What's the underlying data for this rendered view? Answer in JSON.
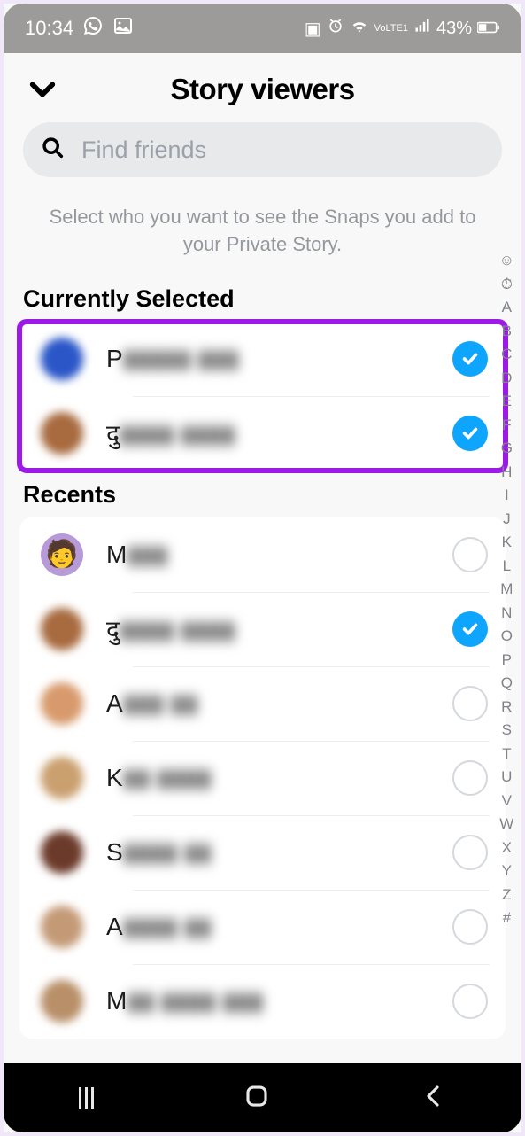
{
  "status": {
    "time": "10:34",
    "battery": "43%",
    "icons": {
      "whatsapp": "whatsapp-icon",
      "screenshot": "image-icon",
      "battery_saver": "battery-saver-icon",
      "alarm": "alarm-icon",
      "wifi": "wifi-icon",
      "volte": "VoLTE1",
      "signal": "signal-icon",
      "batt": "battery-icon"
    }
  },
  "header": {
    "title": "Story viewers"
  },
  "search": {
    "placeholder": "Find friends",
    "value": ""
  },
  "subtitle": "Select who you want to see the Snaps you add to your Private Story.",
  "sections": {
    "selected_title": "Currently Selected",
    "recents_title": "Recents"
  },
  "selected": [
    {
      "first": "P",
      "rest": "▮▮▮▮▮ ▮▮▮",
      "avatar_bg": "#2a56c8",
      "checked": true
    },
    {
      "first": "दु",
      "rest": "▮▮▮▮ ▮▮▮▮",
      "avatar_bg": "#a86a3f",
      "checked": true
    }
  ],
  "recents": [
    {
      "first": "M",
      "rest": "▮▮▮",
      "avatar_bg": "#b79bd8",
      "checked": false,
      "sharp": true
    },
    {
      "first": "दु",
      "rest": "▮▮▮▮ ▮▮▮▮",
      "avatar_bg": "#a86a3f",
      "checked": true
    },
    {
      "first": "A",
      "rest": "▮▮▮ ▮▮",
      "avatar_bg": "#d89a6c",
      "checked": false
    },
    {
      "first": "K",
      "rest": "▮▮ ▮▮▮▮",
      "avatar_bg": "#caa06f",
      "checked": false
    },
    {
      "first": "S",
      "rest": "▮▮▮▮ ▮▮",
      "avatar_bg": "#6b3a2a",
      "checked": false
    },
    {
      "first": "A",
      "rest": "▮▮▮▮ ▮▮",
      "avatar_bg": "#c49a76",
      "checked": false
    },
    {
      "first": "M",
      "rest": "▮▮ ▮▮▮▮ ▮▮▮",
      "avatar_bg": "#b88f68",
      "checked": false
    }
  ],
  "alpha_index": [
    "☺",
    "⏱",
    "A",
    "B",
    "C",
    "D",
    "E",
    "F",
    "G",
    "H",
    "I",
    "J",
    "K",
    "L",
    "M",
    "N",
    "O",
    "P",
    "Q",
    "R",
    "S",
    "T",
    "U",
    "V",
    "W",
    "X",
    "Y",
    "Z",
    "#"
  ],
  "colors": {
    "accent": "#0ea5ff",
    "highlight": "#9d19e8"
  }
}
